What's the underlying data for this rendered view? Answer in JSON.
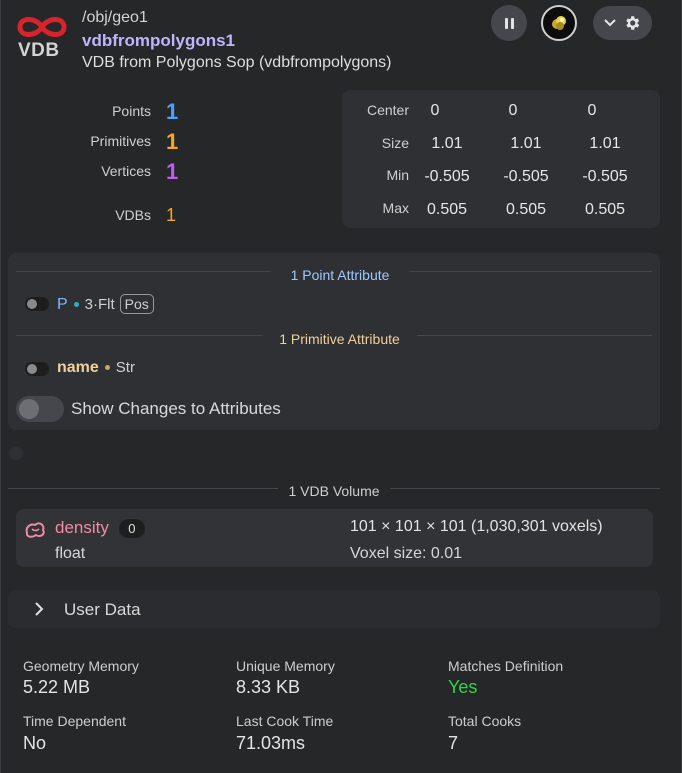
{
  "header": {
    "path": "/obj/geo1",
    "node_name": "vdbfrompolygons1",
    "node_type": "VDB from Polygons Sop (vdbfrompolygons)",
    "logo_text": "VDB"
  },
  "stats": {
    "points": {
      "label": "Points",
      "value": "1"
    },
    "primitives": {
      "label": "Primitives",
      "value": "1"
    },
    "vertices": {
      "label": "Vertices",
      "value": "1"
    },
    "vdbs": {
      "label": "VDBs",
      "value": "1"
    }
  },
  "bbox": {
    "rows": [
      {
        "label": "Center",
        "values": [
          "0",
          "0",
          "0"
        ]
      },
      {
        "label": "Size",
        "values": [
          "1.01",
          "1.01",
          "1.01"
        ]
      },
      {
        "label": "Min",
        "values": [
          "-0.505",
          "-0.505",
          "-0.505"
        ]
      },
      {
        "label": "Max",
        "values": [
          "0.505",
          "0.505",
          "0.505"
        ]
      }
    ]
  },
  "attributes": {
    "point_title": "1 Point Attribute",
    "point_attr": {
      "name": "P",
      "type": "3·Flt",
      "tag": "Pos"
    },
    "prim_title": "1 Primitive Attribute",
    "prim_attr": {
      "name": "name",
      "type": "Str"
    },
    "show_changes_label": "Show Changes to Attributes"
  },
  "vdb": {
    "title": "1 VDB Volume",
    "name": "density",
    "index": "0",
    "data_type": "float",
    "resolution": "101 × 101 × 101 (1,030,301 voxels)",
    "voxel_size": "Voxel size: 0.01"
  },
  "user_data": {
    "label": "User Data"
  },
  "footer": {
    "geometry_memory": {
      "label": "Geometry Memory",
      "value": "5.22 MB"
    },
    "unique_memory": {
      "label": "Unique Memory",
      "value": "8.33 KB"
    },
    "matches_definition": {
      "label": "Matches Definition",
      "value": "Yes"
    },
    "time_dependent": {
      "label": "Time Dependent",
      "value": "No"
    },
    "last_cook_time": {
      "label": "Last Cook Time",
      "value": "71.03ms"
    },
    "total_cooks": {
      "label": "Total Cooks",
      "value": "7"
    }
  },
  "colors": {
    "accent_purple": "#bfb4ff",
    "points_blue": "#4aa3ff",
    "prims_orange": "#f5a623",
    "vertices_purple": "#c15cf2",
    "point_attr_blue": "#7fb7ff",
    "prim_attr_tan": "#f0cf9a",
    "vdb_pink": "#f08aa8",
    "yes_green": "#35d14a",
    "logo_red": "#d9232a"
  }
}
